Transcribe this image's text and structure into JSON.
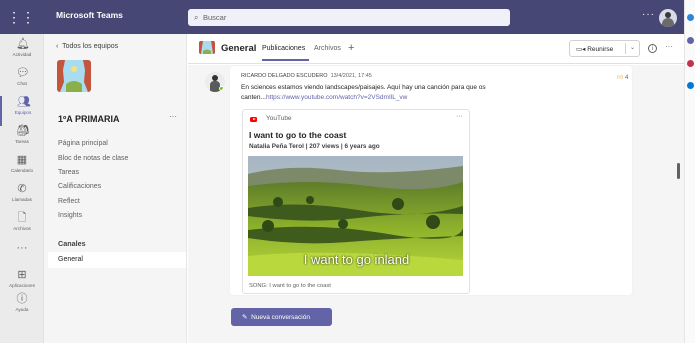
{
  "topbar": {
    "app_title": "Microsoft Teams",
    "search_placeholder": "Buscar",
    "more_label": "···"
  },
  "rail": {
    "items": [
      {
        "label": "Actividad",
        "icon": "bell-icon"
      },
      {
        "label": "Chat",
        "icon": "chat-icon"
      },
      {
        "label": "Equipos",
        "icon": "teams-icon"
      },
      {
        "label": "Tareas",
        "icon": "tasks-icon"
      },
      {
        "label": "Calendario",
        "icon": "calendar-icon"
      },
      {
        "label": "Llamadas",
        "icon": "phone-icon"
      },
      {
        "label": "Archivos",
        "icon": "file-icon"
      },
      {
        "label": "···",
        "icon": "more-icon"
      },
      {
        "label": "Aplicaciones",
        "icon": "apps-icon"
      },
      {
        "label": "Ayuda",
        "icon": "help-icon"
      }
    ],
    "active_index": 2
  },
  "teampanel": {
    "back_label": "Todos los equipos",
    "team_name": "1ºA PRIMARIA",
    "team_more": "···",
    "links": [
      "Página principal",
      "Bloc de notas de clase",
      "Tareas",
      "Calificaciones",
      "Reflect",
      "Insights"
    ],
    "channels_heading": "Canales",
    "channel_general": "General"
  },
  "channel": {
    "name": "General",
    "tab_publicaciones": "Publicaciones",
    "tab_archivos": "Archivos",
    "tab_add": "+",
    "meet_label": "Reunirse",
    "more": "···"
  },
  "post": {
    "author": "RICARDO DELGADO ESCUDERO",
    "timestamp": "13/4/2021, 17:45",
    "text_line1": "En sciences estamos viendo landscapes/paisajes. Aquí hay una canción para que os",
    "text_line2_prefix": "canten...",
    "link": "https://www.youtube.com/watch?v=2VSdmIlL_vw",
    "like_count": "4"
  },
  "youtube_card": {
    "source": "YouTube",
    "more": "···",
    "title": "I want to go to the coast",
    "subtitle": "Natalia Peña Terol | 207 views | 6 years ago",
    "thumbnail_caption": "I want to go inland",
    "description": "SONG: I want to go to the coast"
  },
  "new_conversation_label": "Nueva conversación",
  "colors": {
    "topbar": "#464775",
    "accent": "#6264a7"
  }
}
